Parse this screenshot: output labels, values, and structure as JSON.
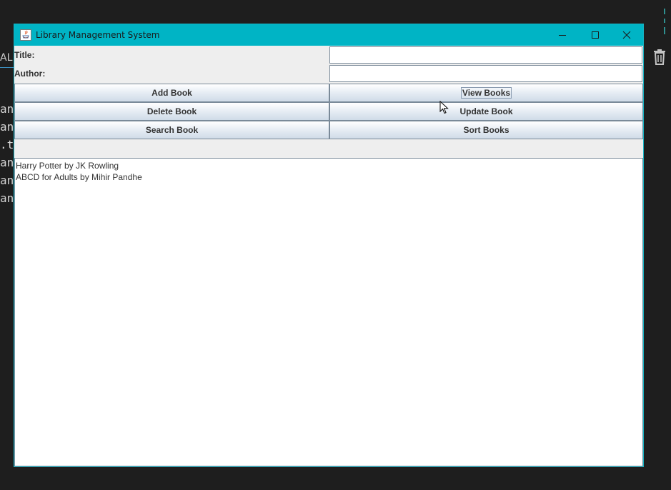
{
  "background": {
    "tab_label": "AL",
    "code_fragments": [
      "ana",
      "ana",
      ".t",
      "ana",
      "ana",
      "ana"
    ],
    "trash_icon": "trash-icon"
  },
  "window": {
    "title": "Library Management System",
    "icon": "java-app-icon",
    "title_bar_color": "#00b4c5",
    "controls": {
      "minimize": "minimize-icon",
      "maximize": "maximize-icon",
      "close": "close-icon"
    }
  },
  "form": {
    "title_label": "Title:",
    "title_value": "",
    "author_label": "Author:",
    "author_value": ""
  },
  "buttons": {
    "add": "Add Book",
    "view": "View Books",
    "delete": "Delete Book",
    "update": "Update Book",
    "search": "Search Book",
    "sort": "Sort Books"
  },
  "output": {
    "lines": [
      "Harry Potter by JK Rowling",
      "ABCD for Adults by Mihir Pandhe"
    ]
  }
}
